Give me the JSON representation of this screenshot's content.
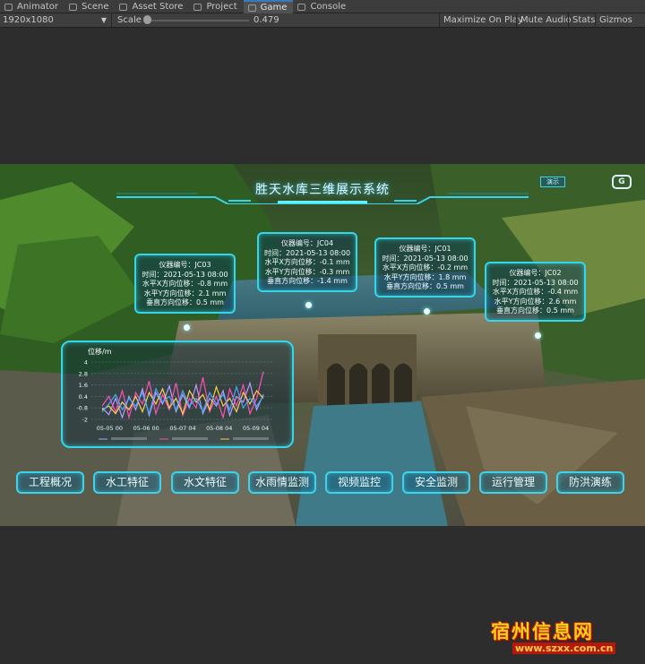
{
  "editor": {
    "tabs": [
      {
        "label": "Animator",
        "icon": "animator-icon"
      },
      {
        "label": "Scene",
        "icon": "scene-icon"
      },
      {
        "label": "Asset Store",
        "icon": "asset-store-icon"
      },
      {
        "label": "Project",
        "icon": "project-icon"
      },
      {
        "label": "Game",
        "icon": "game-icon"
      },
      {
        "label": "Console",
        "icon": "console-icon"
      }
    ],
    "active_tab": "Game",
    "toolbar": {
      "resolution": "1920x1080",
      "scale_label": "Scale",
      "scale_value": "0.479",
      "buttons": [
        "Maximize On Play",
        "Mute Audio",
        "Stats",
        "Gizmos"
      ]
    }
  },
  "app": {
    "title": "胜天水库三维展示系统",
    "top_button": "演示",
    "logo": "G"
  },
  "instruments": [
    {
      "id_label": "仪器编号：JC03",
      "time": "时间：2021-05-13 08:00",
      "x": "水平X方向位移：-0.8 mm",
      "y": "水平Y方向位移：2.1 mm",
      "z": "垂直方向位移：0.5 mm"
    },
    {
      "id_label": "仪器编号：JC04",
      "time": "时间：2021-05-13 08:00",
      "x": "水平X方向位移：-0.1 mm",
      "y": "水平Y方向位移：-0.3 mm",
      "z": "垂直方向位移：-1.4 mm"
    },
    {
      "id_label": "仪器编号：JC01",
      "time": "时间：2021-05-13 08:00",
      "x": "水平X方向位移：-0.2 mm",
      "y": "水平Y方向位移：1.8 mm",
      "z": "垂直方向位移：0.5 mm"
    },
    {
      "id_label": "仪器编号：JC02",
      "time": "时间：2021-05-13 08:00",
      "x": "水平X方向位移：-0.4 mm",
      "y": "水平Y方向位移：2.6 mm",
      "z": "垂直方向位移：0.5 mm"
    }
  ],
  "chart_data": {
    "type": "line",
    "title": "",
    "ylabel": "位移/m",
    "yticks": [
      "4",
      "2.8",
      "1.6",
      "0.4",
      "-0.8",
      "-2"
    ],
    "ylim": [
      -2,
      4
    ],
    "xticks": [
      "05-05 00",
      "05-06 00",
      "05-07 04",
      "05-08 04",
      "05-09 04"
    ],
    "series": [
      {
        "color": "#b89cff",
        "values": [
          -0.8,
          -1.5,
          0.2,
          -1.8,
          0.4,
          -1.0,
          1.2,
          -1.6,
          0.8,
          -0.4,
          1.5,
          -1.2,
          0.6,
          -0.8,
          1.6,
          -1.4,
          0.2,
          -0.6,
          1.0,
          -1.6,
          0.4,
          -0.2,
          1.8,
          -1.0,
          0.6
        ]
      },
      {
        "color": "#ff4fb8",
        "values": [
          -0.6,
          0.4,
          -1.2,
          1.0,
          -1.8,
          0.8,
          -0.4,
          2.0,
          -1.4,
          0.6,
          -1.0,
          1.8,
          -1.6,
          0.2,
          -0.8,
          2.4,
          -1.2,
          0.4,
          -1.8,
          1.2,
          -0.6,
          1.6,
          -1.4,
          0.2,
          3.0
        ]
      },
      {
        "color": "#ffd04a",
        "values": [
          -1.0,
          -0.6,
          -1.4,
          -0.2,
          -1.0,
          0.4,
          -1.2,
          0.8,
          -0.4,
          1.2,
          -0.8,
          0.2,
          -1.4,
          1.0,
          -0.2,
          0.6,
          -1.0,
          1.4,
          -0.6,
          0.2,
          -1.2,
          0.8,
          -0.4,
          1.0,
          0.2
        ]
      },
      {
        "color": "#4aa6ff",
        "values": [
          -1.2,
          -0.4,
          0.6,
          -1.0,
          0.2,
          -0.6,
          0.8,
          -1.4,
          1.2,
          -0.2,
          0.4,
          -1.0,
          1.0,
          -0.6,
          0.2,
          -1.2,
          0.8,
          -0.4,
          0.6,
          -1.0,
          1.4,
          -0.8,
          0.2,
          -0.6,
          0.4
        ]
      }
    ]
  },
  "nav": [
    "工程概况",
    "水工特征",
    "水文特征",
    "水雨情监测",
    "视频监控",
    "安全监测",
    "运行管理",
    "防洪演练"
  ],
  "watermark": {
    "title": "宿州信息网",
    "url": "www.szxx.com.cn"
  },
  "colors": {
    "accent": "#34d6ea",
    "unity_active_tab": "#3a79bb"
  }
}
